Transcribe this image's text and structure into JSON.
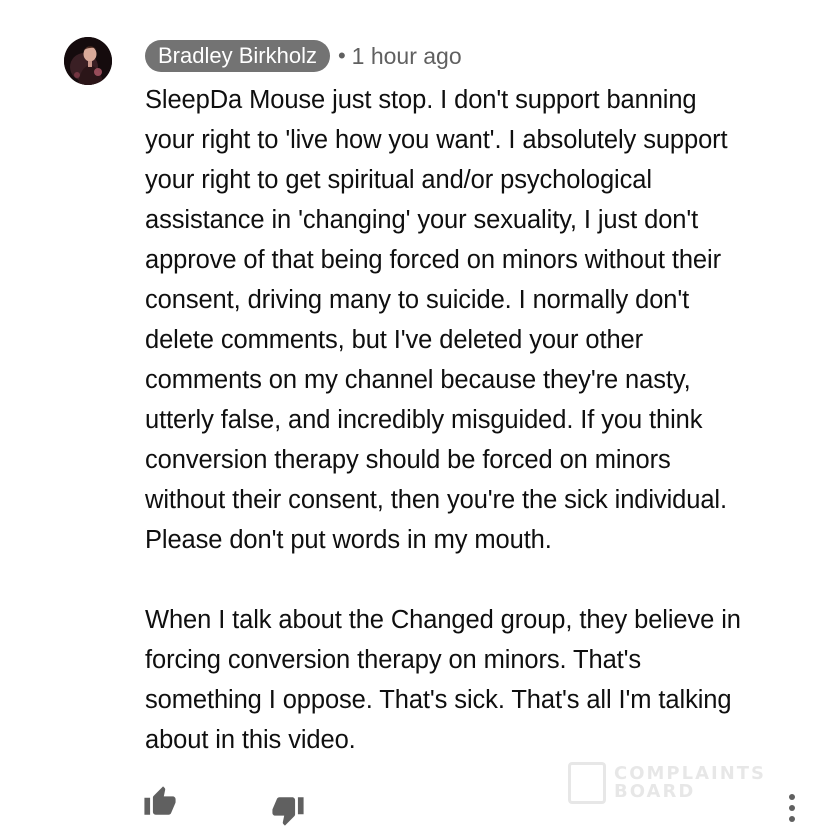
{
  "comment": {
    "author": "Bradley Birkholz",
    "separator": "•",
    "timestamp": "1 hour ago",
    "body": "SleepDa Mouse just stop. I don't support banning\nyour right to 'live how you want'. I absolutely support\nyour right to get spiritual and/or psychological\nassistance in 'changing' your sexuality, I just don't\napprove of that being forced on minors without their\nconsent, driving many to suicide. I normally don't\ndelete comments, but I've deleted your other\ncomments on my channel because they're nasty,\nutterly false, and incredibly misguided. If you think\nconversion therapy should be forced on minors\nwithout their consent, then you're the sick individual.\nPlease don't put words in my mouth.\n\nWhen I talk about the Changed group, they believe in\nforcing conversion therapy on minors. That's\nsomething I oppose. That's sick. That's all I'm talking\nabout in this video."
  },
  "actions": {
    "like_icon": "thumbs-up-icon",
    "dislike_icon": "thumbs-down-icon",
    "more_icon": "more-vertical-icon"
  },
  "watermark": {
    "line1": "COMPLAINTS",
    "line2": "BOARD"
  },
  "colors": {
    "author_chip_bg": "#737373",
    "text": "#0f0f0f",
    "meta": "#606060",
    "icon": "#606060"
  }
}
